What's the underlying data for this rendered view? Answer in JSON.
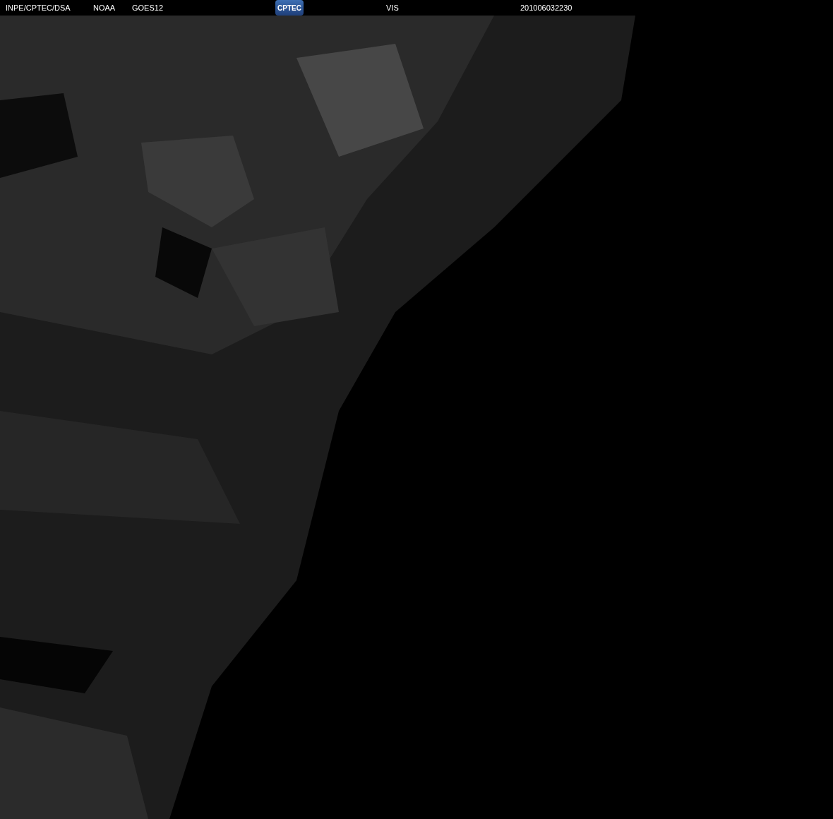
{
  "header": {
    "labels": [
      "INPE/CPTEC/DSA",
      "NOAA",
      "GOES12"
    ],
    "logo": "CPTEC",
    "channel": "VIS",
    "timestamp": "201006032230"
  }
}
